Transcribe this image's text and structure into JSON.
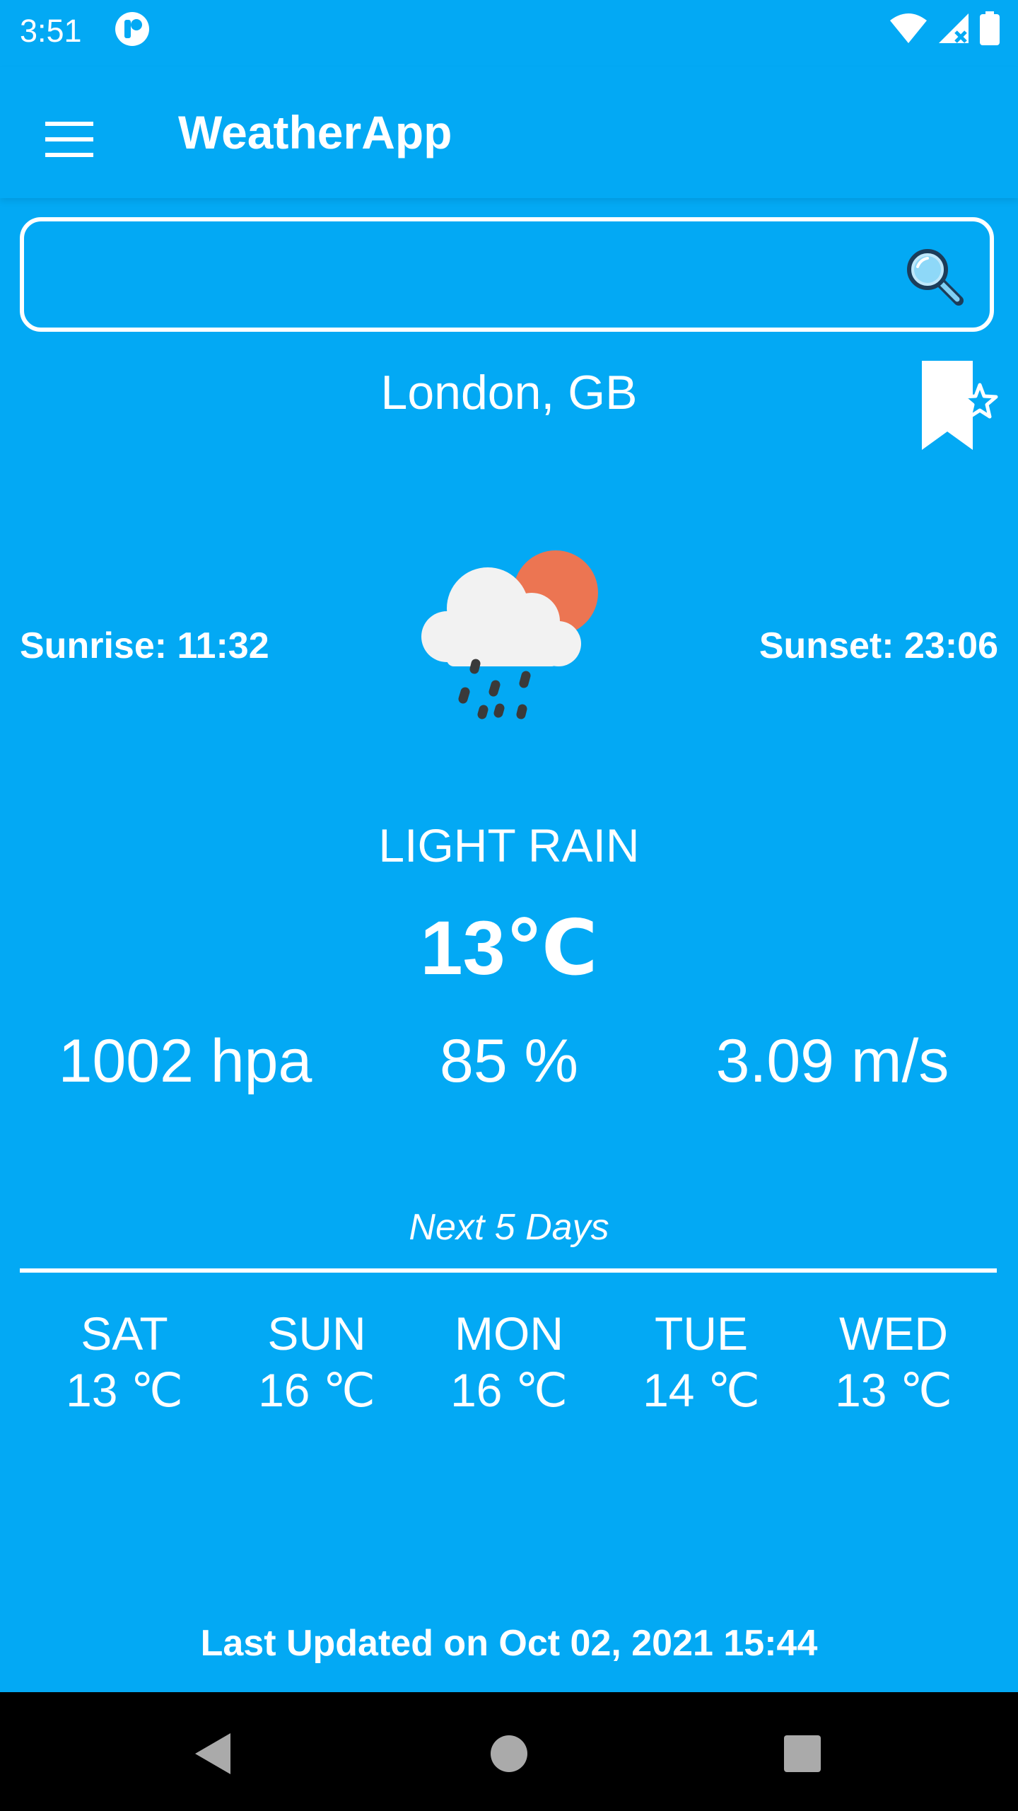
{
  "status_bar": {
    "time": "3:51"
  },
  "app_bar": {
    "title": "WeatherApp"
  },
  "search": {
    "value": "",
    "placeholder": ""
  },
  "location": "London, GB",
  "sun": {
    "sunrise": "Sunrise: 11:32",
    "sunset": "Sunset: 23:06"
  },
  "current": {
    "condition": "LIGHT RAIN",
    "temperature": "13℃",
    "pressure": "1002 hpa",
    "humidity": "85 %",
    "wind": "3.09 m/s",
    "icon": "light-rain-icon"
  },
  "forecast": {
    "heading": "Next 5 Days",
    "days": [
      {
        "day": "SAT",
        "temp": "13 ℃"
      },
      {
        "day": "SUN",
        "temp": "16 ℃"
      },
      {
        "day": "MON",
        "temp": "16 ℃"
      },
      {
        "day": "TUE",
        "temp": "14 ℃"
      },
      {
        "day": "WED",
        "temp": "13 ℃"
      }
    ]
  },
  "last_updated": "Last Updated on Oct 02, 2021 15:44",
  "colors": {
    "background": "#03A9F4",
    "text": "#FFFFFF",
    "sun": "#EC7552",
    "navbar": "#000000"
  }
}
